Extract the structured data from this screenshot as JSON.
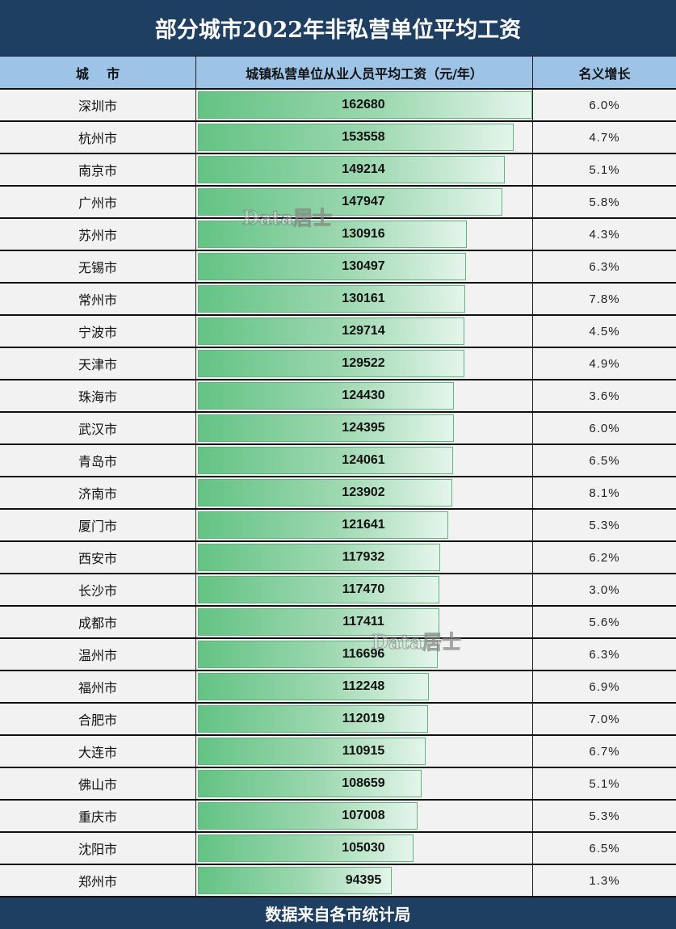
{
  "title": "部分城市2022年非私营单位平均工资",
  "headers": {
    "city": "城    市",
    "salary": "城镇私营单位从业人员平均工资（元/年）",
    "growth": "名义增长"
  },
  "footer": "数据来自各市统计局",
  "watermark": "Data居士",
  "colors": {
    "title_bg": "#1e3e62",
    "header_bg": "#9dc3e6",
    "bar_start": "#63c384",
    "bar_end": "#e4f5eb",
    "row_bg": "#f2f2f2"
  },
  "chart_data": {
    "type": "table",
    "title": "部分城市2022年非私营单位平均工资",
    "columns": [
      "城    市",
      "城镇私营单位从业人员平均工资（元/年）",
      "名义增长"
    ],
    "bar_scale_max": 162680,
    "rows": [
      {
        "city": "深圳市",
        "salary": 162680,
        "growth": "6.0%"
      },
      {
        "city": "杭州市",
        "salary": 153558,
        "growth": "4.7%"
      },
      {
        "city": "南京市",
        "salary": 149214,
        "growth": "5.1%"
      },
      {
        "city": "广州市",
        "salary": 147947,
        "growth": "5.8%"
      },
      {
        "city": "苏州市",
        "salary": 130916,
        "growth": "4.3%"
      },
      {
        "city": "无锡市",
        "salary": 130497,
        "growth": "6.3%"
      },
      {
        "city": "常州市",
        "salary": 130161,
        "growth": "7.8%"
      },
      {
        "city": "宁波市",
        "salary": 129714,
        "growth": "4.5%"
      },
      {
        "city": "天津市",
        "salary": 129522,
        "growth": "4.9%"
      },
      {
        "city": "珠海市",
        "salary": 124430,
        "growth": "3.6%"
      },
      {
        "city": "武汉市",
        "salary": 124395,
        "growth": "6.0%"
      },
      {
        "city": "青岛市",
        "salary": 124061,
        "growth": "6.5%"
      },
      {
        "city": "济南市",
        "salary": 123902,
        "growth": "8.1%"
      },
      {
        "city": "厦门市",
        "salary": 121641,
        "growth": "5.3%"
      },
      {
        "city": "西安市",
        "salary": 117932,
        "growth": "6.2%"
      },
      {
        "city": "长沙市",
        "salary": 117470,
        "growth": "3.0%"
      },
      {
        "city": "成都市",
        "salary": 117411,
        "growth": "5.6%"
      },
      {
        "city": "温州市",
        "salary": 116696,
        "growth": "6.3%"
      },
      {
        "city": "福州市",
        "salary": 112248,
        "growth": "6.9%"
      },
      {
        "city": "合肥市",
        "salary": 112019,
        "growth": "7.0%"
      },
      {
        "city": "大连市",
        "salary": 110915,
        "growth": "6.7%"
      },
      {
        "city": "佛山市",
        "salary": 108659,
        "growth": "5.1%"
      },
      {
        "city": "重庆市",
        "salary": 107008,
        "growth": "5.3%"
      },
      {
        "city": "沈阳市",
        "salary": 105030,
        "growth": "6.5%"
      },
      {
        "city": "郑州市",
        "salary": 94395,
        "growth": "1.3%"
      }
    ],
    "source": "数据来自各市统计局"
  }
}
